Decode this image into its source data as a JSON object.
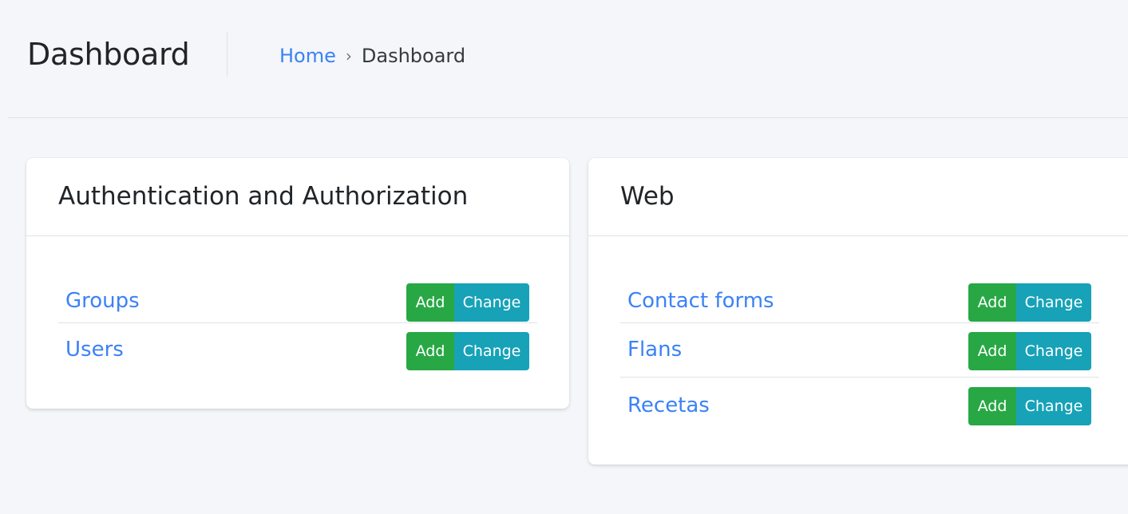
{
  "header": {
    "title": "Dashboard",
    "breadcrumb": {
      "home": "Home",
      "separator": "›",
      "current": "Dashboard"
    }
  },
  "apps": [
    {
      "name": "Authentication and Authorization",
      "models": [
        {
          "name": "Groups",
          "add": "Add",
          "change": "Change"
        },
        {
          "name": "Users",
          "add": "Add",
          "change": "Change"
        }
      ]
    },
    {
      "name": "Web",
      "models": [
        {
          "name": "Contact forms",
          "add": "Add",
          "change": "Change"
        },
        {
          "name": "Flans",
          "add": "Add",
          "change": "Change"
        },
        {
          "name": "Recetas",
          "add": "Add",
          "change": "Change"
        }
      ]
    }
  ],
  "colors": {
    "background": "#f4f6f9",
    "link": "#3b82f6",
    "add_button": "#28a745",
    "change_button": "#17a2b8"
  }
}
